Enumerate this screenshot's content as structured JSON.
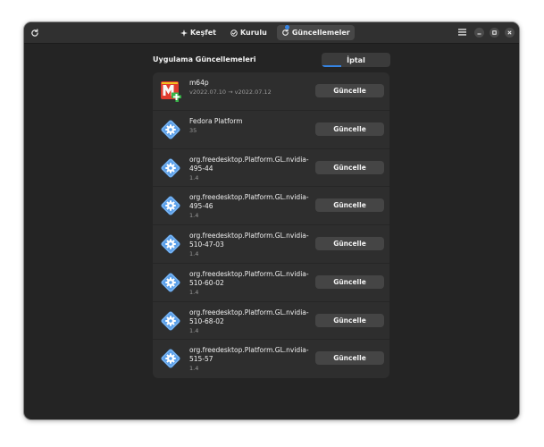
{
  "header": {
    "tabs": [
      {
        "label": "Keşfet",
        "icon": "star-icon",
        "active": false
      },
      {
        "label": "Kurulu",
        "icon": "check-circle-icon",
        "active": false
      },
      {
        "label": "Güncellemeler",
        "icon": "refresh-updates-icon",
        "active": true
      }
    ]
  },
  "updates": {
    "title": "Uygulama Güncellemeleri",
    "cancel_label": "İptal",
    "cancel_progress": 0.28,
    "accent_color": "#3584e4",
    "items": [
      {
        "name": "m64p",
        "version": "v2022.07.10 → v2022.07.12",
        "icon": "m64p-icon",
        "button_label": "Güncelle"
      },
      {
        "name": "Fedora Platform",
        "version": "35",
        "icon": "runtime-gear-icon",
        "button_label": "Güncelle"
      },
      {
        "name": "org.freedesktop.Platform.GL.nvidia-495-44",
        "version": "1.4",
        "icon": "runtime-gear-icon",
        "button_label": "Güncelle"
      },
      {
        "name": "org.freedesktop.Platform.GL.nvidia-495-46",
        "version": "1.4",
        "icon": "runtime-gear-icon",
        "button_label": "Güncelle"
      },
      {
        "name": "org.freedesktop.Platform.GL.nvidia-510-47-03",
        "version": "1.4",
        "icon": "runtime-gear-icon",
        "button_label": "Güncelle"
      },
      {
        "name": "org.freedesktop.Platform.GL.nvidia-510-60-02",
        "version": "1.4",
        "icon": "runtime-gear-icon",
        "button_label": "Güncelle"
      },
      {
        "name": "org.freedesktop.Platform.GL.nvidia-510-68-02",
        "version": "1.4",
        "icon": "runtime-gear-icon",
        "button_label": "Güncelle"
      },
      {
        "name": "org.freedesktop.Platform.GL.nvidia-515-57",
        "version": "1.4",
        "icon": "runtime-gear-icon",
        "button_label": "Güncelle"
      }
    ]
  }
}
